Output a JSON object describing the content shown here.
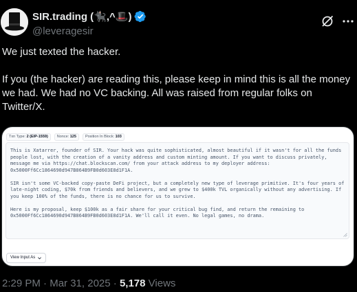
{
  "author": {
    "display_name": "SIR.trading (🐈‍⬛,^🎩)",
    "handle": "@leveragesir",
    "avatar_icon": "top-hat-avatar-icon",
    "verified_icon": "verified-badge-icon"
  },
  "header_actions": {
    "grok_icon": "grok-slash-icon",
    "more_icon": "more-horizontal-icon"
  },
  "tweet": {
    "paragraph_1": "We just texted the hacker.",
    "paragraph_2": "If you (the hacker) are reading this, please keep in mind this is all the money we had. We had no VC backing. All was raised from regular folks on Twitter/X."
  },
  "media": {
    "tags": [
      {
        "label": "Txn Type:",
        "value": "2 (EIP-1559)"
      },
      {
        "label": "Nonce:",
        "value": "125"
      },
      {
        "label": "Position In Block:",
        "value": "103"
      }
    ],
    "message": "This is Xatarrer, founder of SIR. Your hack was quite sophisticated, almost beautiful if it wasn't for all the funds people lost, with the creation of a vanity address and custom minting amount. If you want to discuss privately, message me via https://chat.blockscan.com/ from your attack address to my deployer address: 0x5000Ff6Cc1864690d947B864B9FB0d603E8d1F1A.\n\nSIR isn't some VC-backed copy-paste DeFi project, but a completely new type of leverage primitive. It's four years of late-night coding, $70k from friends and believers, and we grew to $400k TVL organically without any advertising. If you keep 100% of the funds, there is no chance for us to survive.\n\nHere is my proposal, keep $100k as a fair share for your critical bug find, and return the remaining to 0x5000Ff6Cc1864690d947B864B9FB0d603E8d1F1A. We'll call it even. No legal games, no drama.",
    "view_select_label": "View Input As"
  },
  "meta": {
    "time": "2:29 PM",
    "separator_1": " · ",
    "date": "Mar 31, 2025",
    "separator_2": " · ",
    "views_count": "5,178",
    "views_label": " Views"
  },
  "colors": {
    "background": "#000000",
    "text_primary": "#e7e9ea",
    "text_secondary": "#71767b",
    "verified_blue": "#1d9bf0"
  }
}
